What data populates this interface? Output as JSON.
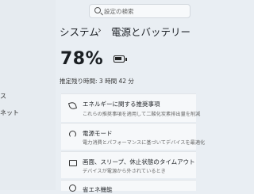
{
  "search": {
    "placeholder": "設定の検索"
  },
  "breadcrumb": {
    "parent": "システム",
    "current": "電源とバッテリー"
  },
  "battery": {
    "percent_text": "78%",
    "remaining": "推定残り時間: 3 時間 42 分"
  },
  "sidebar": {
    "items": [
      "ス",
      "ネット"
    ]
  },
  "cards": [
    {
      "title": "エネルギーに関する推奨事項",
      "subtitle": "これらの推奨事項を適用して二酸化炭素排出量を削減",
      "icon": "leaf-icon"
    },
    {
      "title": "電源モード",
      "subtitle": "電力消費とパフォーマンスに基づいてデバイスを最適化",
      "icon": "gauge-icon"
    },
    {
      "title": "画面、スリープ、休止状態のタイムアウト",
      "subtitle": "デバイスが電源から外されているとき",
      "icon": "screen-icon"
    },
    {
      "title": "省エネ機能",
      "subtitle": "",
      "icon": "last-icon"
    }
  ]
}
